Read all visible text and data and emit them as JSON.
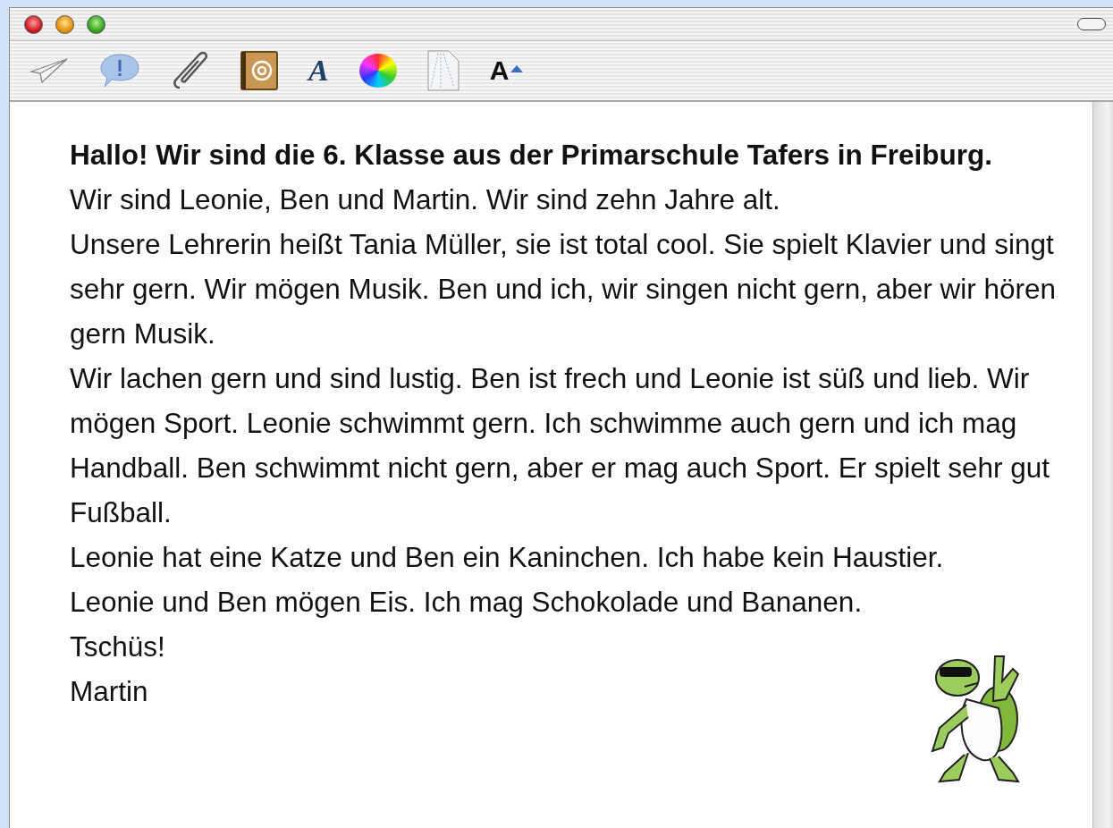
{
  "toolbar": {
    "fonts_glyph": "A",
    "text_size_glyph": "A"
  },
  "message": {
    "heading": "Hallo! Wir sind die 6. Klasse aus der Primarschule Tafers in Freiburg.",
    "paragraphs": [
      "Wir sind Leonie, Ben und Martin. Wir sind zehn Jahre alt.",
      "Unsere Lehrerin heißt Tania Müller, sie ist total cool. Sie spielt Klavier und singt sehr gern. Wir mögen Musik. Ben und ich, wir singen nicht gern, aber wir hören gern Musik.",
      "Wir lachen gern und sind lustig. Ben ist frech und Leonie ist süß und lieb. Wir mögen Sport. Leonie schwimmt gern. Ich schwimme auch gern und ich mag Handball. Ben schwimmt nicht gern, aber er mag auch Sport. Er spielt sehr gut Fußball.",
      "Leonie hat eine Katze und Ben ein Kaninchen. Ich habe kein Haustier.",
      "Leonie und Ben mögen Eis. Ich mag Schokolade und Bananen.",
      "Tschüs!",
      "Martin"
    ]
  }
}
